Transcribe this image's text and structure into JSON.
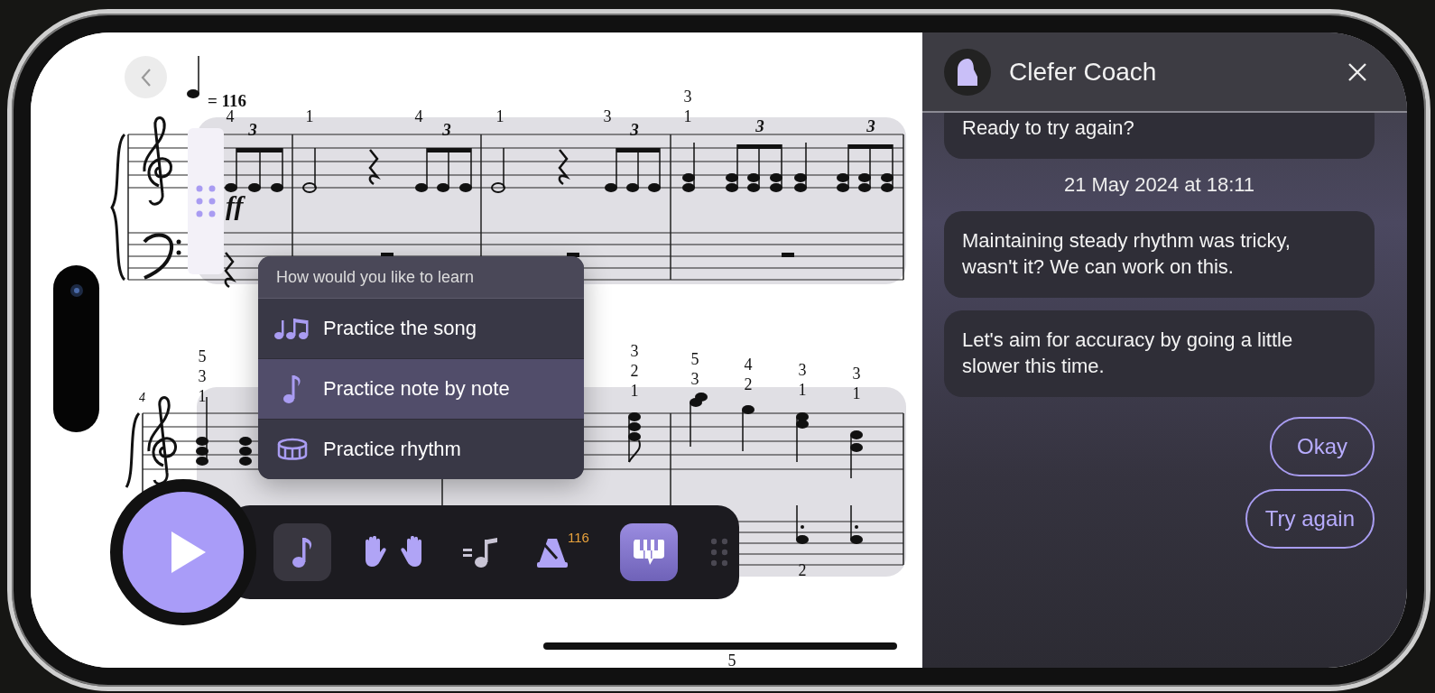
{
  "score": {
    "tempo": "= 116",
    "dynamic": "ff",
    "measure_number": "4",
    "fingerings": [
      "4",
      "1",
      "4",
      "1",
      "3",
      "3",
      "1",
      "5",
      "3",
      "1",
      "3",
      "2",
      "1",
      "5",
      "3",
      "4",
      "2",
      "3",
      "1",
      "3",
      "1",
      "2",
      "5"
    ],
    "triplets": [
      "3",
      "3",
      "3",
      "3",
      "3"
    ]
  },
  "menu": {
    "title": "How would you like to learn",
    "items": [
      {
        "label": "Practice the song",
        "kind": "notes",
        "selected": false
      },
      {
        "label": "Practice note by note",
        "kind": "note",
        "selected": true
      },
      {
        "label": "Practice rhythm",
        "kind": "drum",
        "selected": false
      }
    ]
  },
  "player": {
    "tools": [
      {
        "kind": "note",
        "selected": true
      },
      {
        "kind": "hands"
      },
      {
        "kind": "tempo"
      },
      {
        "kind": "metronome",
        "badge": "116"
      },
      {
        "kind": "coach",
        "selected": true
      },
      {
        "kind": "grip"
      }
    ]
  },
  "coach": {
    "title": "Clefer Coach",
    "messages": [
      {
        "kind": "bubble",
        "text": "Ready to try again?"
      },
      {
        "kind": "timestamp",
        "text": "21 May 2024 at 18:11"
      },
      {
        "kind": "bubble",
        "text": "Maintaining steady rhythm was tricky, wasn't it? We can work on this."
      },
      {
        "kind": "bubble",
        "text": "Let's aim for accuracy by going a little slower this time."
      }
    ],
    "replies": [
      "Okay",
      "Try again"
    ]
  }
}
